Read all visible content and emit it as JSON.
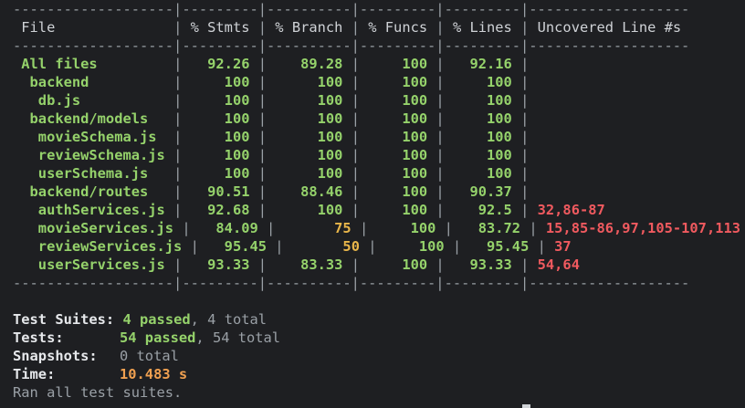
{
  "sep": "-------------------|---------|----------|---------|---------|-------------------",
  "header": [
    "File",
    "% Stmts",
    "% Branch",
    "% Funcs",
    "% Lines",
    "Uncovered Line #s"
  ],
  "rows": [
    {
      "file": "All files",
      "stmts": "92.26",
      "branch": "89.28",
      "funcs": "100",
      "lines": "92.16",
      "uncovered": "",
      "indent": 0,
      "colors": [
        "g",
        "g",
        "g",
        "g",
        "g",
        "g"
      ]
    },
    {
      "file": "backend",
      "stmts": "100",
      "branch": "100",
      "funcs": "100",
      "lines": "100",
      "uncovered": "",
      "indent": 1,
      "colors": [
        "g",
        "g",
        "g",
        "g",
        "g",
        "g"
      ]
    },
    {
      "file": "db.js",
      "stmts": "100",
      "branch": "100",
      "funcs": "100",
      "lines": "100",
      "uncovered": "",
      "indent": 2,
      "colors": [
        "g",
        "g",
        "g",
        "g",
        "g",
        "g"
      ]
    },
    {
      "file": "backend/models",
      "stmts": "100",
      "branch": "100",
      "funcs": "100",
      "lines": "100",
      "uncovered": "",
      "indent": 1,
      "colors": [
        "g",
        "g",
        "g",
        "g",
        "g",
        "g"
      ]
    },
    {
      "file": "movieSchema.js",
      "stmts": "100",
      "branch": "100",
      "funcs": "100",
      "lines": "100",
      "uncovered": "",
      "indent": 2,
      "colors": [
        "g",
        "g",
        "g",
        "g",
        "g",
        "g"
      ]
    },
    {
      "file": "reviewSchema.js",
      "stmts": "100",
      "branch": "100",
      "funcs": "100",
      "lines": "100",
      "uncovered": "",
      "indent": 2,
      "colors": [
        "g",
        "g",
        "g",
        "g",
        "g",
        "g"
      ]
    },
    {
      "file": "userSchema.js",
      "stmts": "100",
      "branch": "100",
      "funcs": "100",
      "lines": "100",
      "uncovered": "",
      "indent": 2,
      "colors": [
        "g",
        "g",
        "g",
        "g",
        "g",
        "g"
      ]
    },
    {
      "file": "backend/routes",
      "stmts": "90.51",
      "branch": "88.46",
      "funcs": "100",
      "lines": "90.37",
      "uncovered": "",
      "indent": 1,
      "colors": [
        "g",
        "g",
        "g",
        "g",
        "g",
        "g"
      ]
    },
    {
      "file": "authServices.js",
      "stmts": "92.68",
      "branch": "100",
      "funcs": "100",
      "lines": "92.5",
      "uncovered": "32,86-87",
      "indent": 2,
      "colors": [
        "g",
        "g",
        "g",
        "g",
        "g",
        "r"
      ]
    },
    {
      "file": "movieServices.js",
      "stmts": "84.09",
      "branch": "75",
      "funcs": "100",
      "lines": "83.72",
      "uncovered": "15,85-86,97,105-107,113",
      "indent": 2,
      "colors": [
        "g",
        "g",
        "y",
        "g",
        "g",
        "r"
      ]
    },
    {
      "file": "reviewServices.js",
      "stmts": "95.45",
      "branch": "50",
      "funcs": "100",
      "lines": "95.45",
      "uncovered": "37",
      "indent": 2,
      "colors": [
        "g",
        "g",
        "y",
        "g",
        "g",
        "r"
      ]
    },
    {
      "file": "userServices.js",
      "stmts": "93.33",
      "branch": "83.33",
      "funcs": "100",
      "lines": "93.33",
      "uncovered": "54,64",
      "indent": 2,
      "colors": [
        "g",
        "g",
        "g",
        "g",
        "g",
        "r"
      ]
    }
  ],
  "summary": {
    "suites_label": "Test Suites:",
    "suites_passed": "4 passed",
    "suites_total": ", 4 total",
    "tests_label": "Tests:",
    "tests_passed": "54 passed",
    "tests_total": ", 54 total",
    "snapshots_label": "Snapshots:",
    "snapshots_value": "0 total",
    "time_label": "Time:",
    "time_value": "10.483 s",
    "ran": "Ran all test suites."
  }
}
